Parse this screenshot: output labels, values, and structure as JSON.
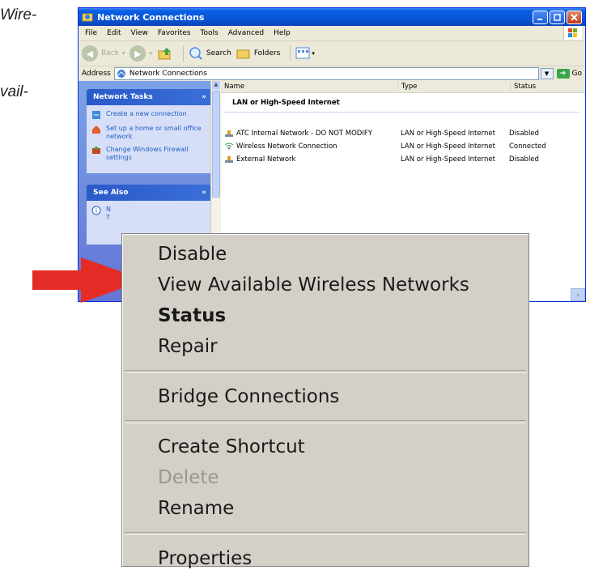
{
  "page_fragments": [
    "Wire-",
    "vail-"
  ],
  "window": {
    "title": "Network Connections",
    "menu": [
      "File",
      "Edit",
      "View",
      "Favorites",
      "Tools",
      "Advanced",
      "Help"
    ],
    "toolbar": {
      "back": "Back",
      "search": "Search",
      "folders": "Folders"
    },
    "address": {
      "label": "Address",
      "value": "Network Connections",
      "go": "Go"
    }
  },
  "sidebar": {
    "tasks_title": "Network Tasks",
    "tasks": [
      {
        "label": "Create a new connection",
        "icon": "new-connection-icon"
      },
      {
        "label": "Set up a home or small office network",
        "icon": "home-network-icon"
      },
      {
        "label": "Change Windows Firewall settings",
        "icon": "firewall-icon"
      }
    ],
    "see_also_title": "See Also",
    "see_also_partial": "N",
    "see_also_partial2": "T"
  },
  "list": {
    "columns": [
      "Name",
      "Type",
      "Status"
    ],
    "group": "LAN or High-Speed Internet",
    "rows": [
      {
        "name": "ATC Internal Network - DO NOT MODIFY",
        "type": "LAN or High-Speed Internet",
        "status": "Disabled",
        "icon": "lan-icon"
      },
      {
        "name": "Wireless Network Connection",
        "type": "LAN or High-Speed Internet",
        "status": "Connected",
        "icon": "wireless-icon"
      },
      {
        "name": "External Network",
        "type": "LAN or High-Speed Internet",
        "status": "Disabled",
        "icon": "lan-icon"
      }
    ]
  },
  "context_menu": {
    "items": [
      {
        "label": "Disable",
        "bold": false,
        "disabled": false
      },
      {
        "label": "View Available Wireless Networks",
        "bold": false,
        "disabled": false
      },
      {
        "label": "Status",
        "bold": true,
        "disabled": false
      },
      {
        "label": "Repair",
        "bold": false,
        "disabled": false
      },
      {
        "label": "Bridge Connections",
        "bold": false,
        "disabled": false
      },
      {
        "label": "Create Shortcut",
        "bold": false,
        "disabled": false
      },
      {
        "label": "Delete",
        "bold": false,
        "disabled": true
      },
      {
        "label": "Rename",
        "bold": false,
        "disabled": false
      },
      {
        "label": "Properties",
        "bold": false,
        "disabled": false
      }
    ]
  },
  "colors": {
    "title_bar": "#0a56d8",
    "sidebar": "#6f8ddf",
    "menu_bg": "#d4d0c8",
    "arrow": "#e52b25"
  }
}
